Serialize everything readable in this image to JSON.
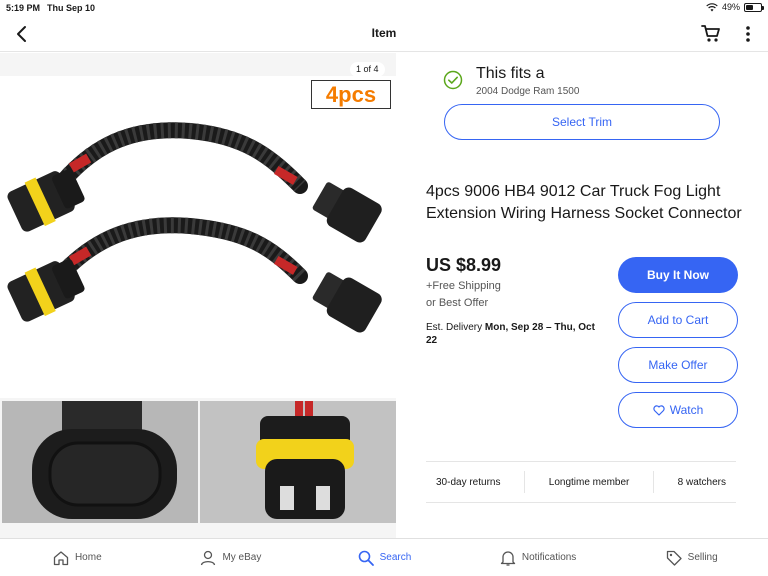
{
  "status": {
    "time": "5:19 PM",
    "date": "Thu Sep 10",
    "battery": "49%",
    "battery_level": 0.49
  },
  "nav": {
    "title": "Item"
  },
  "gallery": {
    "counter": "1 of 4",
    "badge": "4pcs",
    "thumbnail_count": 4,
    "selected_thumbnail": 1
  },
  "fitment": {
    "title": "This fits a",
    "vehicle": "2004 Dodge Ram 1500",
    "select_trim": "Select Trim"
  },
  "item": {
    "title": "4pcs 9006 HB4 9012 Car Truck Fog Light Extension Wiring Harness Socket Connector",
    "price": "US $8.99",
    "shipping": "+Free Shipping",
    "offer": "or Best Offer",
    "delivery_label": "Est. Delivery",
    "delivery_dates": "Mon, Sep 28 – Thu, Oct 22"
  },
  "actions": {
    "buy_now": "Buy It Now",
    "add_to_cart": "Add to Cart",
    "make_offer": "Make Offer",
    "watch": "Watch"
  },
  "trust": {
    "returns": "30-day returns",
    "member": "Longtime member",
    "watchers": "8 watchers"
  },
  "tabs": [
    {
      "label": "Home",
      "icon": "home-icon"
    },
    {
      "label": "My eBay",
      "icon": "person-icon"
    },
    {
      "label": "Search",
      "icon": "search-icon",
      "active": true
    },
    {
      "label": "Notifications",
      "icon": "bell-icon"
    },
    {
      "label": "Selling",
      "icon": "tag-icon"
    }
  ],
  "colors": {
    "accent": "#3665f3",
    "success": "#5ba71b",
    "badge_text": "#f57c00"
  }
}
